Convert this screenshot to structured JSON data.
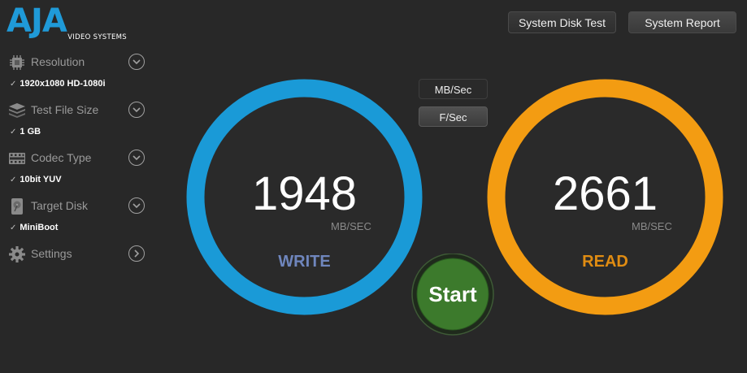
{
  "brand": {
    "logo": "AJA",
    "sub": "VIDEO SYSTEMS"
  },
  "toolbar": {
    "system_disk_test": "System Disk Test",
    "system_report": "System Report"
  },
  "sidebar": {
    "resolution": {
      "label": "Resolution",
      "value": "1920x1080 HD-1080i",
      "icon": "chip-icon"
    },
    "file_size": {
      "label": "Test File Size",
      "value": "1 GB",
      "icon": "stack-icon"
    },
    "codec": {
      "label": "Codec Type",
      "value": "10bit YUV",
      "icon": "filmstrip-icon"
    },
    "disk": {
      "label": "Target Disk",
      "value": "MiniBoot",
      "icon": "hard-disk-icon"
    },
    "settings": {
      "label": "Settings",
      "icon": "gear-icon"
    }
  },
  "units": {
    "mb_sec": "MB/Sec",
    "f_sec": "F/Sec"
  },
  "write": {
    "value": "1948",
    "unit": "MB/SEC",
    "label": "WRITE",
    "color": "#1a9ad7",
    "label_color": "#6f86bd"
  },
  "read": {
    "value": "2661",
    "unit": "MB/SEC",
    "label": "READ",
    "color": "#f39c12",
    "label_color": "#e08c12"
  },
  "start": {
    "label": "Start",
    "color": "#3c7a2c"
  }
}
